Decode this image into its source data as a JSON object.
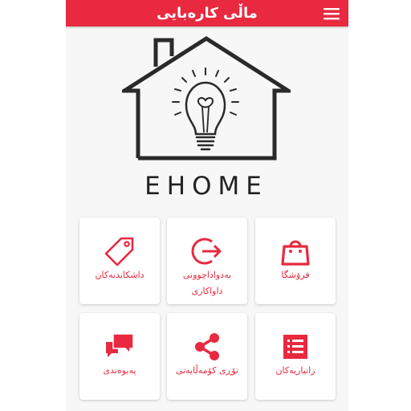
{
  "appbar": {
    "title": "ماڵی کارەبایی",
    "menu_icon": "hamburger-menu-icon",
    "color": "#e8293f"
  },
  "logo": {
    "text": "EHOME"
  },
  "grid": {
    "accent": "#e8293f",
    "items": [
      {
        "label": "فرۆشگا",
        "icon": "shopping-bag-icon"
      },
      {
        "label": "بەدواداچوونی داواکاری",
        "icon": "sign-out-arrow-icon"
      },
      {
        "label": "داشکاندنەکان",
        "icon": "price-tag-icon"
      },
      {
        "label": "زانیاریەکان",
        "icon": "list-icon"
      },
      {
        "label": "تۆڕی کۆمەڵایەتی",
        "icon": "share-icon"
      },
      {
        "label": "پەیوەندی",
        "icon": "chat-bubbles-icon"
      }
    ]
  }
}
